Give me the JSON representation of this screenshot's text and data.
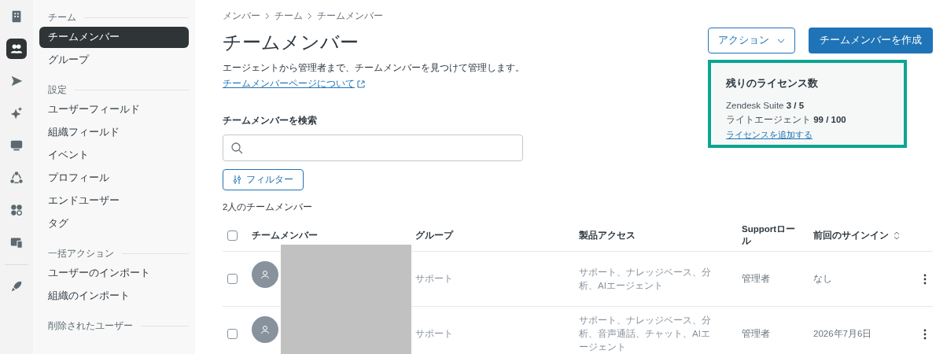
{
  "rail": {
    "items": [
      {
        "selected": false
      },
      {
        "selected": true
      },
      {
        "selected": false
      },
      {
        "selected": false
      },
      {
        "selected": false
      },
      {
        "selected": false
      },
      {
        "selected": false
      },
      {
        "selected": false
      },
      {
        "selected": false
      }
    ]
  },
  "sidebar": {
    "sections": [
      {
        "title": "チーム",
        "items": [
          {
            "label": "チームメンバー",
            "selected": true
          },
          {
            "label": "グループ",
            "selected": false
          }
        ]
      },
      {
        "title": "設定",
        "items": [
          {
            "label": "ユーザーフィールド",
            "selected": false
          },
          {
            "label": "組織フィールド",
            "selected": false
          },
          {
            "label": "イベント",
            "selected": false
          },
          {
            "label": "プロフィール",
            "selected": false
          },
          {
            "label": "エンドユーザー",
            "selected": false
          },
          {
            "label": "タグ",
            "selected": false
          }
        ]
      },
      {
        "title": "一括アクション",
        "items": [
          {
            "label": "ユーザーのインポート",
            "selected": false
          },
          {
            "label": "組織のインポート",
            "selected": false
          }
        ]
      },
      {
        "title": "削除されたユーザー"
      }
    ]
  },
  "breadcrumb": [
    "メンバー",
    "チーム",
    "チームメンバー"
  ],
  "page": {
    "title": "チームメンバー",
    "description": "エージェントから管理者まで、チームメンバーを見つけて管理します。",
    "link": "チームメンバーページについて"
  },
  "actions": {
    "menu_button": "アクション",
    "primary_button": "チームメンバーを作成"
  },
  "license_card": {
    "title": "残りのライセンス数",
    "lines": [
      {
        "label": "Zendesk Suite",
        "value": "3 / 5"
      },
      {
        "label": "ライトエージェント",
        "value": "99 / 100"
      }
    ],
    "link": "ライセンスを追加する"
  },
  "search": {
    "label": "チームメンバーを検索"
  },
  "filter_button": "フィルター",
  "count": "2人のチームメンバー",
  "table": {
    "select_all_checked": false,
    "columns": [
      {
        "label": "チームメンバー",
        "sortable": false
      },
      {
        "label": "グループ",
        "sortable": false
      },
      {
        "label": "製品アクセス",
        "sortable": false
      },
      {
        "label": "Supportロール",
        "sortable": false
      },
      {
        "label": "前回のサインイン",
        "sortable": true
      }
    ],
    "rows": [
      {
        "checked": false,
        "group": "サポート",
        "access": "サポート、ナレッジベース、分析、AIエージェント",
        "role": "管理者",
        "last_sign_in": "なし"
      },
      {
        "checked": false,
        "group": "サポート",
        "access": "サポート、ナレッジベース、分析、音声通話、チャット、AIエージェント",
        "role": "管理者",
        "last_sign_in": "2026年7月6日"
      }
    ]
  }
}
